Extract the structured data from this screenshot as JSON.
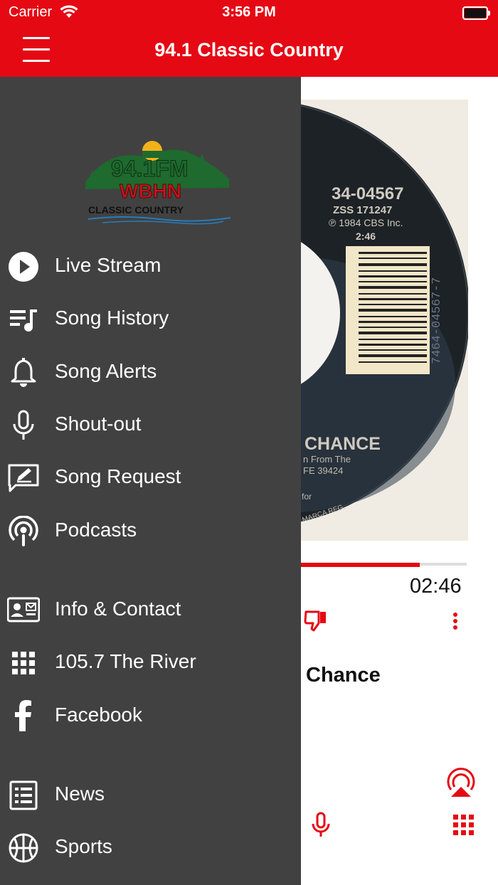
{
  "status_bar": {
    "carrier": "Carrier",
    "time": "3:56 PM"
  },
  "header": {
    "title": "94.1 Classic Country",
    "menu_icon": "hamburger-icon"
  },
  "logo": {
    "line1": "94.1FM",
    "line2": "WBHN",
    "line3": "CLASSIC COUNTRY"
  },
  "album_art": {
    "catalog": "34-04567",
    "zss": "ZSS 171247",
    "copyright": "℗ 1984 CBS Inc.",
    "length": "2:46",
    "barcode": "7464-04567-7",
    "label_title": "CHANCE",
    "label_sub": "n From The",
    "label_sub2": "FE 39424",
    "label_for": "for",
    "label_reg": "MARCA REG."
  },
  "player": {
    "progress": 0.9,
    "end_time": "02:46",
    "song_title": "Chance",
    "accent": "#e50914"
  },
  "menu": {
    "items": [
      {
        "label": "Live Stream",
        "icon": "play-circle-icon"
      },
      {
        "label": "Song History",
        "icon": "playlist-icon"
      },
      {
        "label": "Song Alerts",
        "icon": "bell-icon"
      },
      {
        "label": "Shout-out",
        "icon": "microphone-icon"
      },
      {
        "label": "Song Request",
        "icon": "edit-message-icon"
      },
      {
        "label": "Podcasts",
        "icon": "podcast-icon"
      },
      {
        "label": "Info & Contact",
        "icon": "contact-card-icon"
      },
      {
        "label": "105.7 The River",
        "icon": "grid-icon"
      },
      {
        "label": "Facebook",
        "icon": "facebook-icon"
      },
      {
        "label": "News",
        "icon": "newspaper-icon"
      },
      {
        "label": "Sports",
        "icon": "basketball-icon"
      }
    ]
  },
  "colors": {
    "header": "#e50914",
    "drawer": "#414141",
    "text_on_drawer": "#ffffff"
  }
}
